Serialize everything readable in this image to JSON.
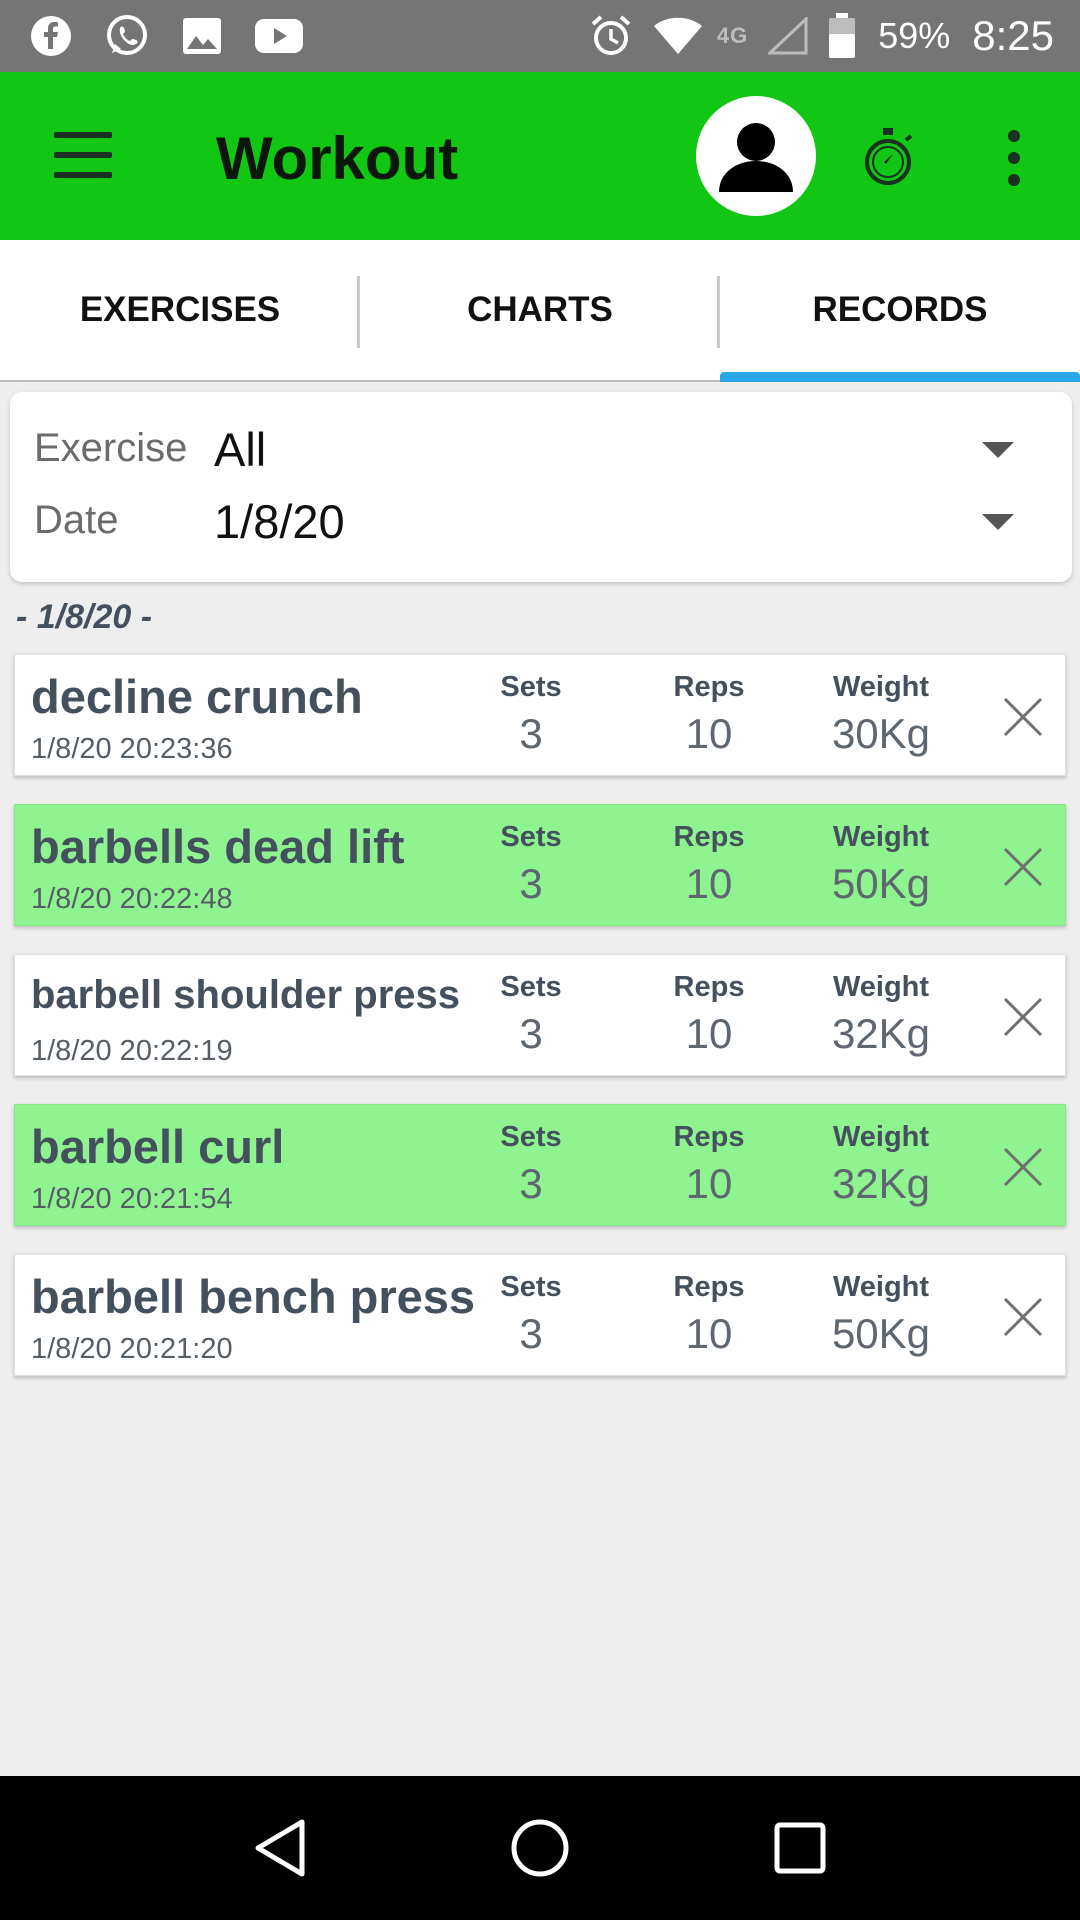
{
  "status_bar": {
    "left_icons": [
      "facebook-icon",
      "whatsapp-icon",
      "gallery-icon",
      "youtube-icon"
    ],
    "network": "4G",
    "battery": "59%",
    "time": "8:25"
  },
  "app_bar": {
    "title": "Workout",
    "background": "#12c614"
  },
  "tabs": [
    {
      "label": "EXERCISES",
      "active": false
    },
    {
      "label": "CHARTS",
      "active": false
    },
    {
      "label": "RECORDS",
      "active": true
    }
  ],
  "filters": {
    "exercise_label": "Exercise",
    "exercise_value": "All",
    "date_label": "Date",
    "date_value": "1/8/20"
  },
  "date_group": "- 1/8/20 -",
  "stat_labels": {
    "sets": "Sets",
    "reps": "Reps",
    "weight": "Weight"
  },
  "records": [
    {
      "name": "decline crunch",
      "time": "1/8/20  20:23:36",
      "sets": "3",
      "reps": "10",
      "weight": "30Kg",
      "highlight": false
    },
    {
      "name": "barbells dead lift",
      "time": "1/8/20  20:22:48",
      "sets": "3",
      "reps": "10",
      "weight": "50Kg",
      "highlight": true
    },
    {
      "name": "barbell shoulder press",
      "time": "1/8/20  20:22:19",
      "sets": "3",
      "reps": "10",
      "weight": "32Kg",
      "highlight": false
    },
    {
      "name": "barbell curl",
      "time": "1/8/20  20:21:54",
      "sets": "3",
      "reps": "10",
      "weight": "32Kg",
      "highlight": true
    },
    {
      "name": "barbell bench press",
      "time": "1/8/20  20:21:20",
      "sets": "3",
      "reps": "10",
      "weight": "50Kg",
      "highlight": false
    }
  ],
  "colors": {
    "highlight_row": "#8ff48f",
    "tab_indicator": "#29a7e8",
    "text_primary": "#44505e"
  }
}
